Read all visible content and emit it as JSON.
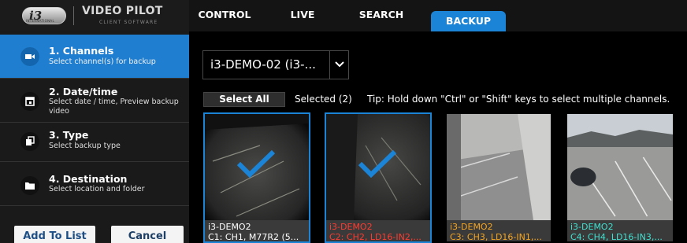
{
  "brand": {
    "logo": "i3 INTERNATIONAL",
    "title": "VIDEO PILOT",
    "subtitle": "CLIENT SOFTWARE"
  },
  "nav": {
    "tabs": [
      {
        "label": "CONTROL",
        "active": false
      },
      {
        "label": "LIVE",
        "active": false
      },
      {
        "label": "SEARCH",
        "active": false
      },
      {
        "label": "BACKUP",
        "active": true
      }
    ]
  },
  "sidebar": {
    "steps": [
      {
        "title": "1. Channels",
        "desc": "Select channel(s) for backup",
        "icon": "camera-icon",
        "active": true
      },
      {
        "title": "2. Date/time",
        "desc": "Select date / time, Preview backup video",
        "icon": "calendar-icon",
        "active": false
      },
      {
        "title": "3. Type",
        "desc": "Select backup type",
        "icon": "copy-icon",
        "active": false
      },
      {
        "title": "4. Destination",
        "desc": "Select location and folder",
        "icon": "folder-icon",
        "active": false
      }
    ],
    "add_label": "Add To List",
    "cancel_label": "Cancel"
  },
  "main": {
    "server_select": "i3-DEMO-02 (i3-...",
    "select_all_label": "Select All",
    "selected_count": "Selected (2)",
    "tip": "Tip: Hold down \"Ctrl\" or \"Shift\" keys to select multiple channels.",
    "channels": [
      {
        "device": "i3-DEMO2",
        "label": "C1: CH1, M77R2 (5...",
        "selected": true,
        "color": "#ffffff"
      },
      {
        "device": "i3-DEMO2",
        "label": "C2: CH2, LD16-IN2,...",
        "selected": true,
        "color": "#ff3b30"
      },
      {
        "device": "i3-DEMO2",
        "label": "C3: CH3, LD16-IN1,...",
        "selected": false,
        "color": "#f5a623"
      },
      {
        "device": "i3-DEMO2",
        "label": "C4: CH4, LD16-IN3,...",
        "selected": false,
        "color": "#3fe0d0"
      }
    ]
  },
  "colors": {
    "accent": "#1c84d6",
    "sidebar": "#1a1a1a"
  }
}
